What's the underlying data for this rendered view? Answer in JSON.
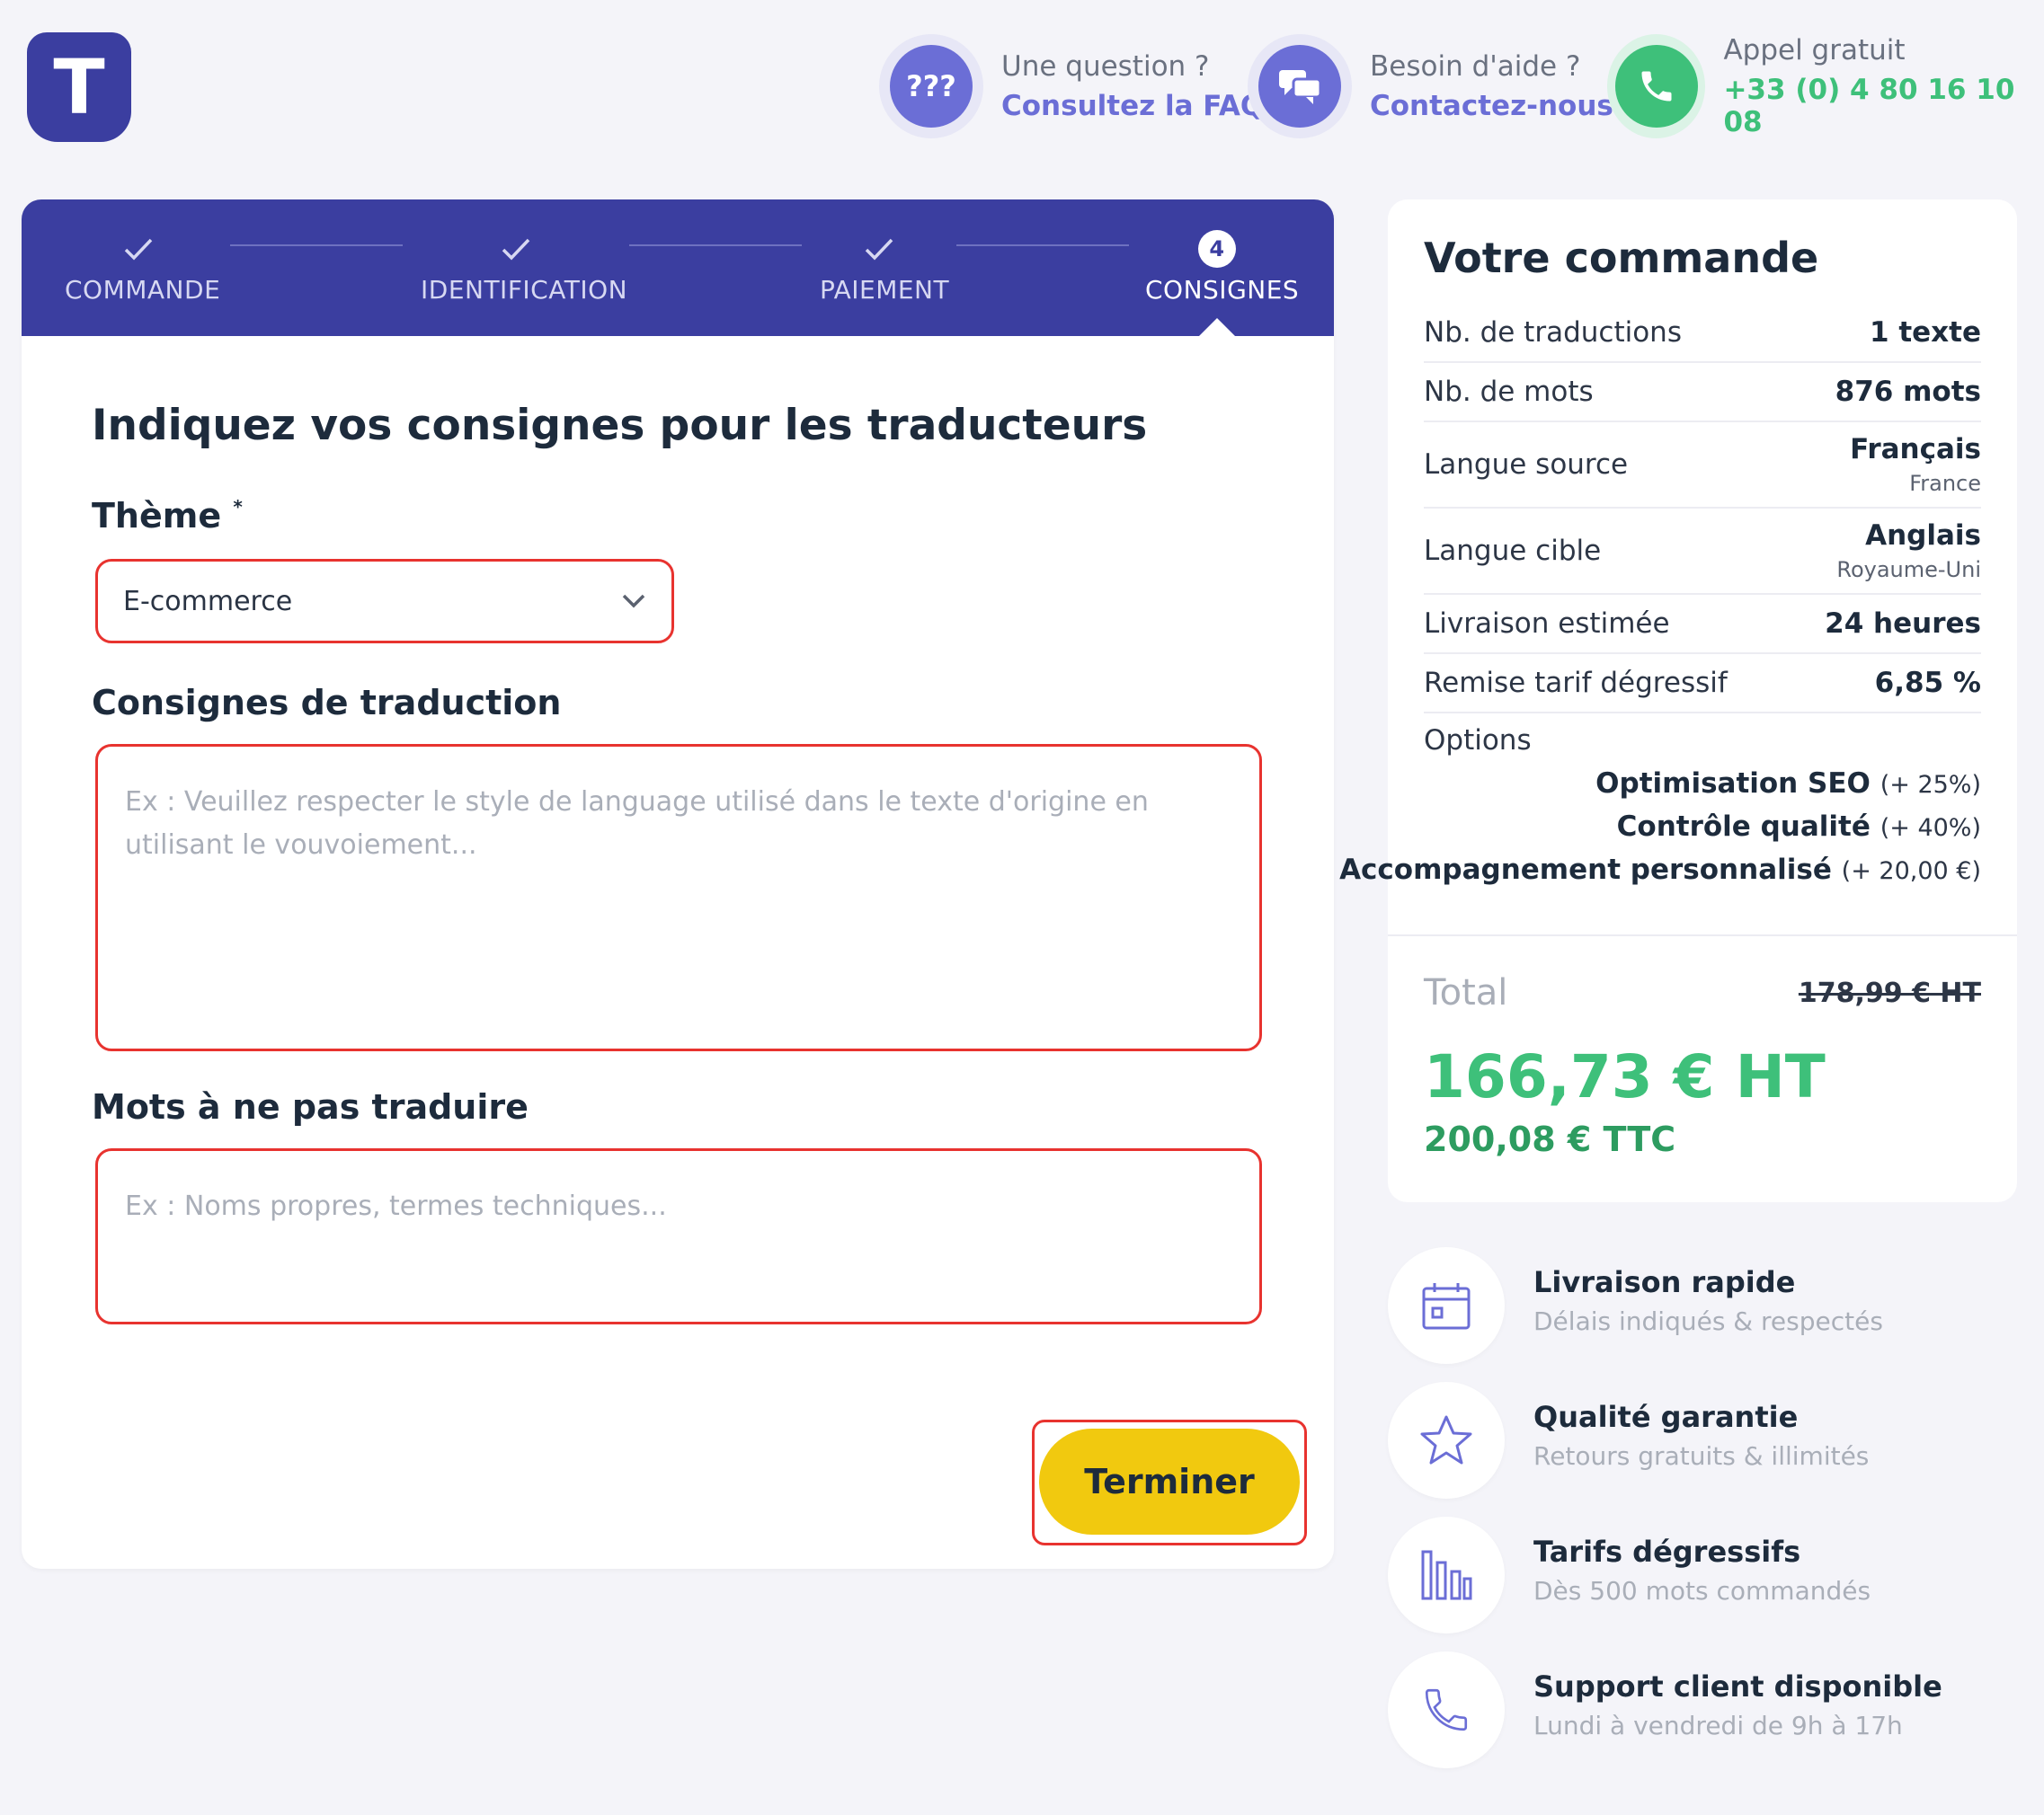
{
  "logo": {
    "letter": "T"
  },
  "header": {
    "faq": {
      "icon": "question-marks-icon",
      "line1": "Une question ?",
      "line2": "Consultez la FAQ",
      "glyph": "???"
    },
    "contact": {
      "icon": "chat-bubbles-icon",
      "line1": "Besoin d'aide ?",
      "line2": "Contactez-nous"
    },
    "phone": {
      "icon": "phone-icon",
      "line1": "Appel gratuit",
      "line2": "+33 (0) 4 80 16 10 08"
    }
  },
  "stepper": {
    "steps": [
      {
        "label": "COMMANDE",
        "state": "done"
      },
      {
        "label": "IDENTIFICATION",
        "state": "done"
      },
      {
        "label": "PAIEMENT",
        "state": "done"
      },
      {
        "label": "CONSIGNES",
        "state": "active",
        "number": "4"
      }
    ]
  },
  "form": {
    "title": "Indiquez vos consignes pour les traducteurs",
    "theme_label": "Thème",
    "theme_required": "*",
    "theme_value": "E-commerce",
    "instructions_label": "Consignes de traduction",
    "instructions_placeholder": "Ex : Veuillez respecter le style de language utilisé dans le texte d'origine en utilisant le vouvoiement...",
    "nontranslate_label": "Mots à ne pas traduire",
    "nontranslate_placeholder": "Ex : Noms propres, termes techniques...",
    "submit_label": "Terminer"
  },
  "summary": {
    "title": "Votre commande",
    "rows": [
      {
        "label": "Nb. de traductions",
        "value": "1 texte"
      },
      {
        "label": "Nb. de mots",
        "value": "876 mots"
      },
      {
        "label": "Langue source",
        "value": "Français",
        "sub": "France"
      },
      {
        "label": "Langue cible",
        "value": "Anglais",
        "sub": "Royaume-Uni"
      },
      {
        "label": "Livraison estimée",
        "value": "24 heures"
      },
      {
        "label": "Remise tarif dégressif",
        "value": "6,85 %"
      }
    ],
    "options_label": "Options",
    "options": [
      {
        "name": "Optimisation SEO",
        "extra": "(+ 25%)"
      },
      {
        "name": "Contrôle qualité",
        "extra": "(+ 40%)"
      },
      {
        "name": "Accompagnement personnalisé",
        "extra": "(+ 20,00 €)"
      }
    ],
    "total_label": "Total",
    "total_old": "178,99 € HT",
    "total_ht": "166,73 € HT",
    "total_ttc": "200,08 € TTC"
  },
  "features": [
    {
      "icon": "calendar-icon",
      "title": "Livraison rapide",
      "subtitle": "Délais indiqués & respectés"
    },
    {
      "icon": "star-icon",
      "title": "Qualité garantie",
      "subtitle": "Retours gratuits & illimités"
    },
    {
      "icon": "bar-chart-icon",
      "title": "Tarifs dégressifs",
      "subtitle": "Dès 500 mots commandés"
    },
    {
      "icon": "phone-icon",
      "title": "Support client disponible",
      "subtitle": "Lundi à vendredi de 9h à 17h"
    }
  ],
  "colors": {
    "brand": "#3b3ea0",
    "accent_green": "#3ec07a",
    "button_yellow": "#f1c90f",
    "highlight_red": "#e8332f",
    "link_purple": "#6b6ed6"
  }
}
